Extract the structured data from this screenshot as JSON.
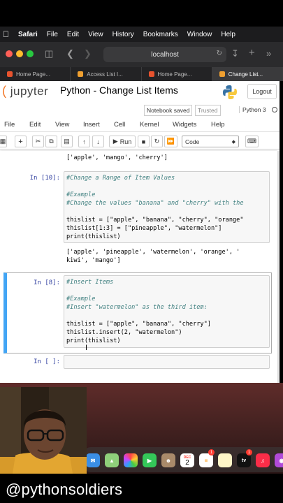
{
  "menubar": {
    "app_name": "Safari",
    "items": [
      "File",
      "Edit",
      "View",
      "History",
      "Bookmarks",
      "Window",
      "Help"
    ]
  },
  "toolbar": {
    "url": "localhost"
  },
  "tabs": [
    {
      "label": "Home Page...",
      "color": "#e8532e"
    },
    {
      "label": "Access List I...",
      "color": "#f0a030"
    },
    {
      "label": "Home Page...",
      "color": "#e8532e"
    },
    {
      "label": "Change List...",
      "color": "#f0a030"
    }
  ],
  "jupyter": {
    "logo_text": "upyter",
    "notebook_title": "Python - Change List Items",
    "logout_label": "Logout",
    "status": "Notebook saved",
    "trusted": "Trusted",
    "kernel": "Python 3",
    "menu": [
      "File",
      "Edit",
      "View",
      "Insert",
      "Cell",
      "Kernel",
      "Widgets",
      "Help"
    ],
    "run_label": "Run",
    "cell_type": "Code"
  },
  "cells": {
    "prev_output": "['apple', 'mango', 'cherry']",
    "cell10": {
      "prompt": "In [10]:",
      "lines": [
        "#Change a Range of Item Values",
        "",
        "#Example",
        "#Change the values \"banana\" and \"cherry\" with the",
        "",
        "thislist = [\"apple\", \"banana\", \"cherry\", \"orange\"",
        "thislist[1:3] = [\"pineapple\", \"watermelon\"]",
        "print(thislist)"
      ],
      "output": [
        "['apple', 'pineapple', 'watermelon', 'orange', '",
        "kiwi', 'mango']"
      ]
    },
    "cell8": {
      "prompt": "In [8]:",
      "lines": [
        "#Insert Items",
        "",
        "#Example",
        "#Insert \"watermelon\" as the third item:",
        "",
        "thislist = [\"apple\", \"banana\", \"cherry\"]",
        "thislist.insert(2, \"watermelon\")",
        "print(thislist)"
      ]
    },
    "empty_prompt": "In [ ]:"
  },
  "dock": {
    "calendar_month": "DEC",
    "calendar_day": "2",
    "tv_label": "tv",
    "badge": "1"
  },
  "watermark": "@pythonsoldiers"
}
